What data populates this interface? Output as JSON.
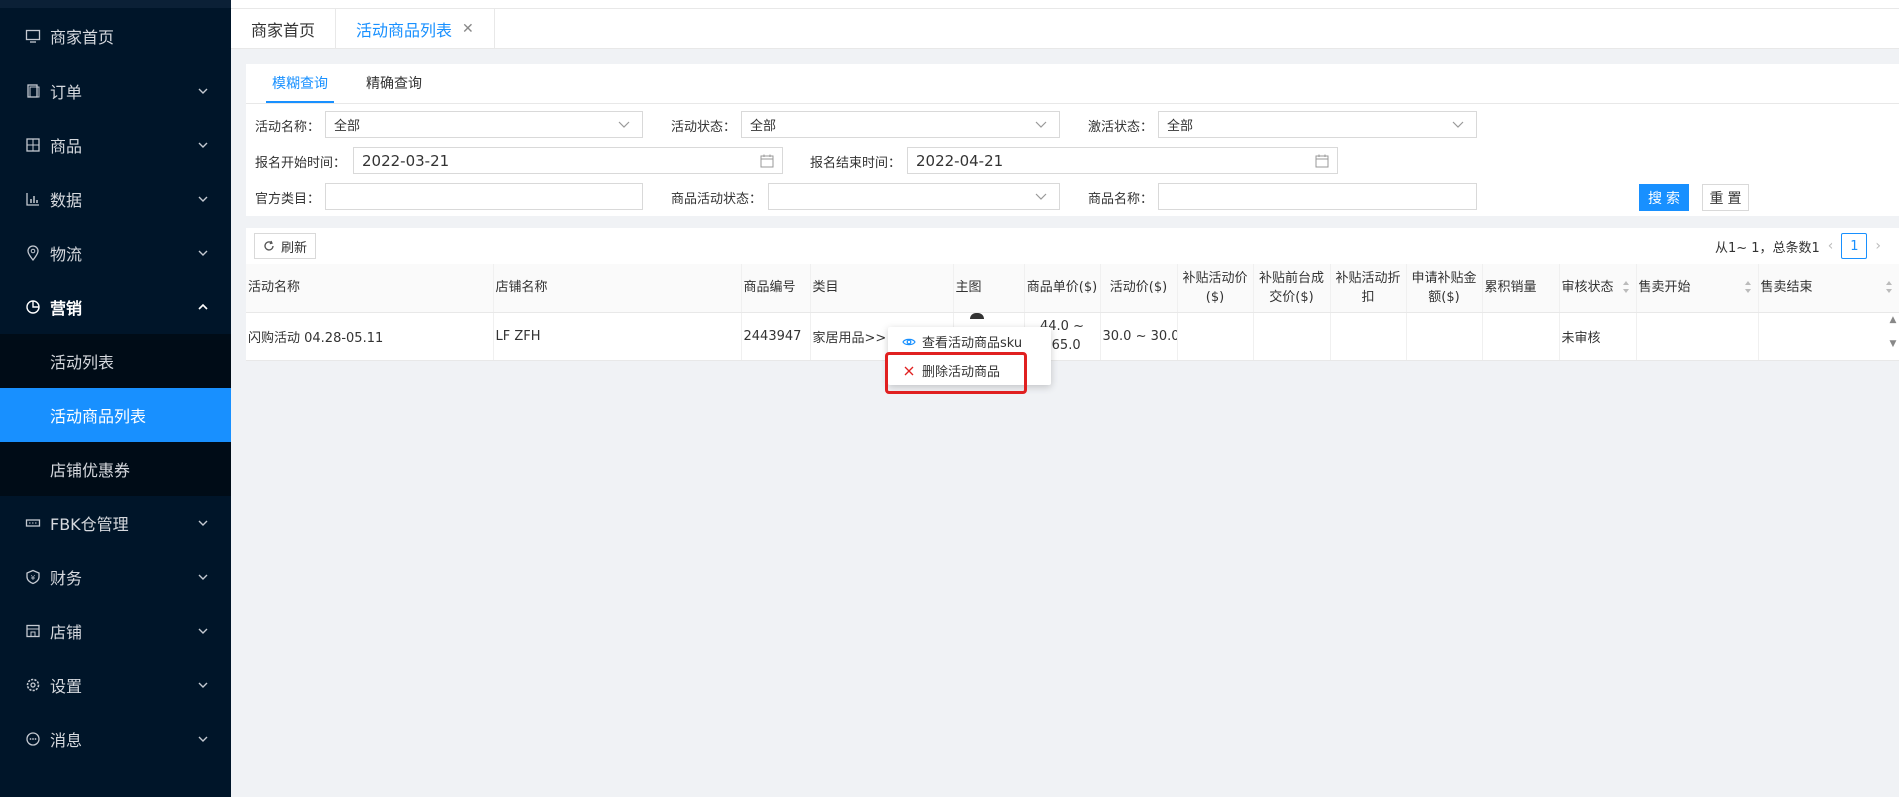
{
  "sidebar": {
    "items": [
      {
        "label": "商家首页",
        "icon": "monitor-icon",
        "has_children": false
      },
      {
        "label": "订单",
        "icon": "order-icon",
        "has_children": true
      },
      {
        "label": "商品",
        "icon": "goods-icon",
        "has_children": true
      },
      {
        "label": "数据",
        "icon": "chart-icon",
        "has_children": true
      },
      {
        "label": "物流",
        "icon": "location-icon",
        "has_children": true
      },
      {
        "label": "营销",
        "icon": "pie-icon",
        "has_children": true,
        "open": true
      },
      {
        "label": "FBK仓管理",
        "icon": "warehouse-icon",
        "has_children": true
      },
      {
        "label": "财务",
        "icon": "shield-icon",
        "has_children": true
      },
      {
        "label": "店铺",
        "icon": "store-icon",
        "has_children": true
      },
      {
        "label": "设置",
        "icon": "gear-icon",
        "has_children": true
      },
      {
        "label": "消息",
        "icon": "message-icon",
        "has_children": true
      }
    ],
    "marketing_sub": [
      {
        "label": "活动列表"
      },
      {
        "label": "活动商品列表",
        "active": true
      },
      {
        "label": "店铺优惠券"
      }
    ]
  },
  "tabs": {
    "home": "商家首页",
    "current": "活动商品列表",
    "close": "✕"
  },
  "query_tabs": {
    "fuzzy": "模糊查询",
    "exact": "精确查询"
  },
  "form": {
    "activity_name_label": "活动名称：",
    "activity_name_value": "全部",
    "activity_status_label": "活动状态：",
    "activity_status_value": "全部",
    "activation_status_label": "激活状态：",
    "activation_status_value": "全部",
    "signup_start_label": "报名开始时间：",
    "signup_start_value": "2022-03-21",
    "signup_end_label": "报名结束时间：",
    "signup_end_value": "2022-04-21",
    "official_category_label": "官方类目：",
    "official_category_value": "",
    "goods_activity_status_label": "商品活动状态：",
    "goods_activity_status_value": "",
    "goods_name_label": "商品名称：",
    "goods_name_value": "",
    "search_button": "搜索",
    "reset_button": "重置"
  },
  "toolbar": {
    "refresh": "刷新",
    "pager_text": "从1~ 1，总条数1",
    "prev": "‹",
    "next": "›",
    "current_page": "1"
  },
  "table": {
    "headers": {
      "activity_name": "活动名称",
      "store_name": "店铺名称",
      "goods_no": "商品编号",
      "category": "类目",
      "main_image": "主图",
      "unit_price": "商品单价($)",
      "activity_price": "活动价($)",
      "subsidy_activity_price": "补贴活动价($)",
      "subsidy_before_price": "补贴前台成交价($)",
      "subsidy_discount": "补贴活动折扣",
      "apply_subsidy_amount": "申请补贴金额($)",
      "total_sales": "累积销量",
      "review_status": "审核状态",
      "sale_start": "售卖开始",
      "sale_end": "售卖结束"
    },
    "rows": [
      {
        "activity_name": "闪购活动 04.28-05.11",
        "store_name": "LF ZFH",
        "goods_no": "2443947",
        "category": "家居用品>>",
        "unit_price": "44.0 ~ 465.0",
        "activity_price": "30.0 ~ 30.0",
        "subsidy_activity_price": "",
        "subsidy_before_price": "",
        "subsidy_discount": "",
        "apply_subsidy_amount": "",
        "total_sales": "",
        "review_status": "未审核",
        "sale_start": "",
        "sale_end": ""
      }
    ]
  },
  "context_menu": {
    "view_sku": "查看活动商品sku",
    "delete": "删除活动商品"
  },
  "colors": {
    "sidebar_bg": "#001529",
    "accent": "#1890ff",
    "highlight": "#e02020"
  }
}
